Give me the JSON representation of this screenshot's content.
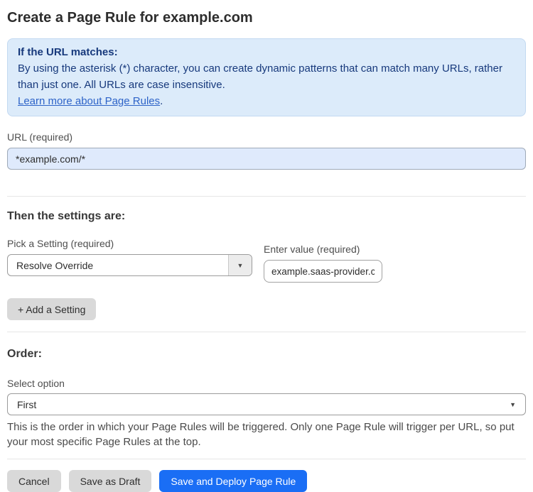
{
  "page": {
    "title": "Create a Page Rule for example.com"
  },
  "info_box": {
    "heading": "If the URL matches:",
    "body": "By using the asterisk (*) character, you can create dynamic patterns that can match many URLs, rather than just one. All URLs are case insensitive.",
    "link_label": "Learn more about Page Rules",
    "link_suffix": "."
  },
  "url_field": {
    "label": "URL (required)",
    "value": "*example.com/*"
  },
  "settings": {
    "heading": "Then the settings are:",
    "pick_setting": {
      "label": "Pick a Setting (required)",
      "selected": "Resolve Override"
    },
    "enter_value": {
      "label": "Enter value (required)",
      "value": "example.saas-provider.c"
    },
    "add_button_label": "+ Add a Setting"
  },
  "order": {
    "heading": "Order:",
    "select_label": "Select option",
    "selected": "First",
    "help_text": "This is the order in which your Page Rules will be triggered. Only one Page Rule will trigger per URL, so put your most specific Page Rules at the top."
  },
  "footer": {
    "cancel_label": "Cancel",
    "save_draft_label": "Save as Draft",
    "deploy_label": "Save and Deploy Page Rule"
  },
  "icons": {
    "dropdown_caret": "▼"
  },
  "colors": {
    "accent_blue": "#1a6ef5",
    "info_box_bg": "#dcebfa",
    "info_box_border": "#c3d9f1",
    "info_text": "#17397c",
    "link_blue": "#2d63c8",
    "url_input_bg": "#dfeafc",
    "gray_button_bg": "#d9d9d9"
  }
}
